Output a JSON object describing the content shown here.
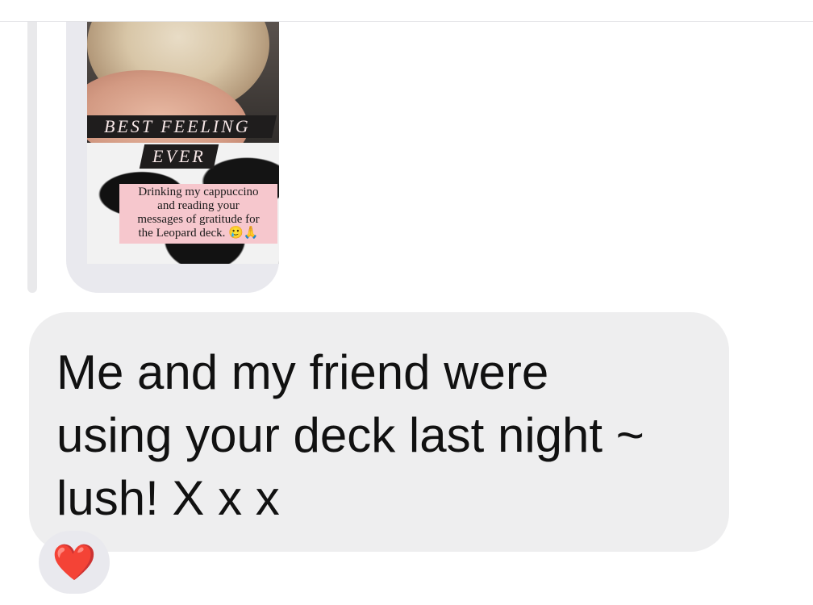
{
  "story_reply": {
    "overlay_title": "BEST FEELING",
    "overlay_subtitle": "EVER",
    "caption_lines": [
      "Drinking my cappuccino",
      "and reading your",
      "messages of gratitude for",
      "the Leopard deck. 🥲🙏"
    ]
  },
  "message": {
    "lines": [
      "Me and my friend were",
      "using your deck last night ~",
      "lush! X x x"
    ]
  },
  "reaction": {
    "emoji": "❤️"
  },
  "colors": {
    "bubble_bg": "#eeeeef",
    "story_frame_bg": "#e9e9ee",
    "caption_bg": "#f6c7cd",
    "title_bg": "#1f1d1d",
    "reaction_heart": "#ea3a3a"
  }
}
